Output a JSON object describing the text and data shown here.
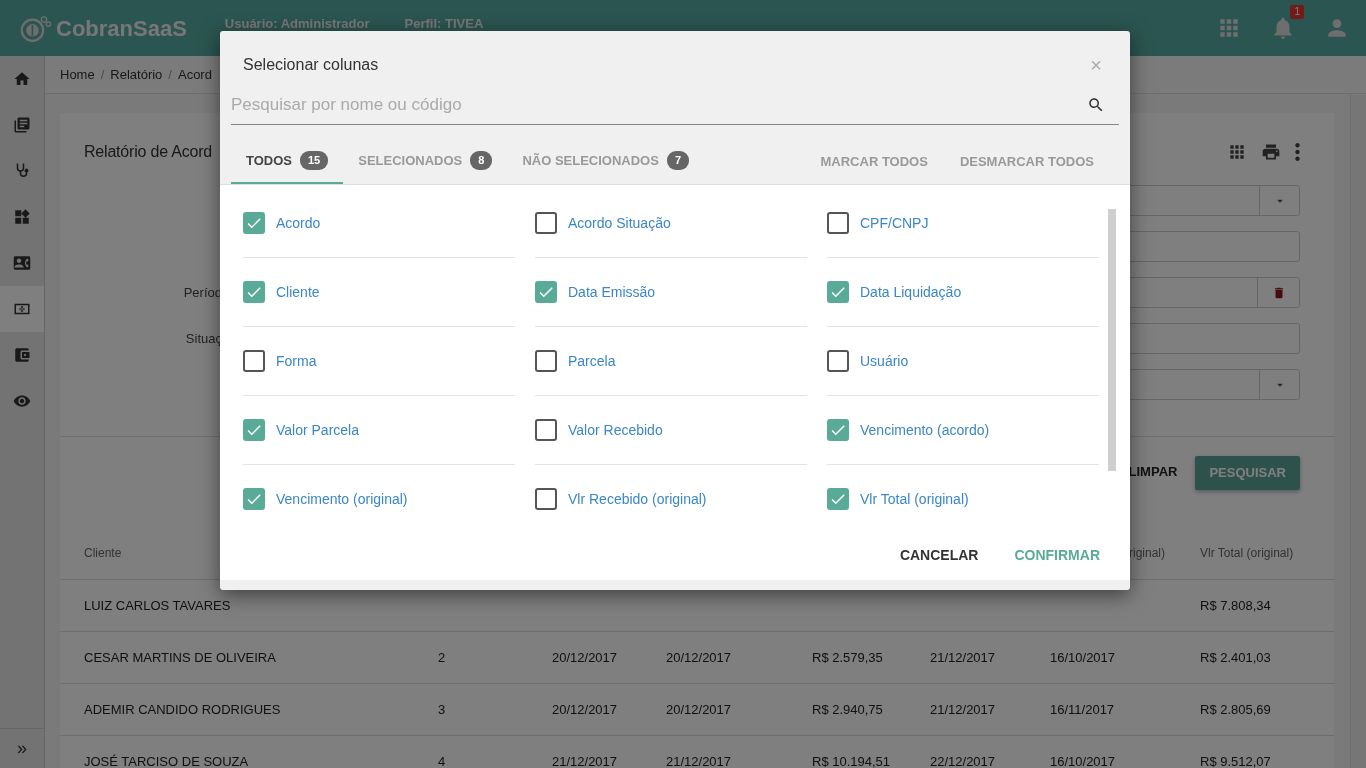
{
  "topbar": {
    "logo": "CobranSaaS",
    "user": "Usuário: Administrador",
    "profile": "Perfil: TIVEA",
    "notifications": "1"
  },
  "sidebar": {
    "items": [
      {
        "kind": "home",
        "selected": false
      },
      {
        "kind": "books",
        "selected": false
      },
      {
        "kind": "stethoscope",
        "selected": false
      },
      {
        "kind": "widgets",
        "selected": false
      },
      {
        "kind": "contact",
        "selected": false
      },
      {
        "kind": "money",
        "selected": true
      },
      {
        "kind": "wallet",
        "selected": false
      },
      {
        "kind": "eye",
        "selected": false
      }
    ],
    "collapse": "»"
  },
  "breadcrumb": {
    "items": [
      "Home",
      "Relatório",
      "Acord"
    ],
    "separators": [
      "/",
      "/"
    ]
  },
  "report": {
    "title": "Relatório de Acord",
    "fields": [
      {
        "kind": "select"
      },
      {
        "kind": "input"
      },
      {
        "kind": "input-clear",
        "label": "Períod"
      },
      {
        "kind": "input",
        "label": "Situaç"
      },
      {
        "kind": "select"
      }
    ],
    "buttons": [
      "LIMPAR",
      "PESQUISAR"
    ]
  },
  "table": {
    "header": {
      "column_1": "Cliente",
      "column_7": "riginal)",
      "column_8": "Vlr Total (original)"
    },
    "rows": [
      {
        "column_1": "LUIZ CARLOS TAVARES",
        "column_8": "R$ 7.808,34"
      },
      {
        "column_1": "CESAR MARTINS DE OLIVEIRA",
        "column_2": "2",
        "column_3": "20/12/2017",
        "column_4": "20/12/2017",
        "column_5": "R$ 2.579,35",
        "column_6": "21/12/2017",
        "column_7": "16/10/2017",
        "column_8": "R$ 2.401,03"
      },
      {
        "column_1": "ADEMIR CANDIDO RODRIGUES",
        "column_2": "3",
        "column_3": "20/12/2017",
        "column_4": "20/12/2017",
        "column_5": "R$ 2.940,75",
        "column_6": "21/12/2017",
        "column_7": "16/11/2017",
        "column_8": "R$ 2.805,69"
      },
      {
        "column_1": "JOSÉ TARCISO DE SOUZA",
        "column_2": "4",
        "column_3": "21/12/2017",
        "column_4": "21/12/2017",
        "column_5": "R$ 10.194,51",
        "column_6": "22/12/2017",
        "column_7": "16/10/2017",
        "column_8": "R$ 9.512,07"
      }
    ]
  },
  "modal": {
    "title": "Selecionar colunas",
    "close": "×",
    "search": {
      "placeholder": "Pesquisar por nome ou código"
    },
    "tabs": [
      {
        "label": "TODOS",
        "count": "15",
        "selected": true
      },
      {
        "label": "SELECIONADOS",
        "count": "8",
        "selected": false
      },
      {
        "label": "NÃO SELECIONADOS",
        "count": "7",
        "selected": false
      }
    ],
    "actions": [
      "MARCAR TODOS",
      "DESMARCAR TODOS"
    ],
    "columns": [
      {
        "label": "Acordo",
        "checked": true
      },
      {
        "label": "Acordo Situação",
        "checked": false
      },
      {
        "label": "CPF/CNPJ",
        "checked": false
      },
      {
        "label": "Cliente",
        "checked": true
      },
      {
        "label": "Data Emissão",
        "checked": true
      },
      {
        "label": "Data Liquidação",
        "checked": true
      },
      {
        "label": "Forma",
        "checked": false
      },
      {
        "label": "Parcela",
        "checked": false
      },
      {
        "label": "Usuário",
        "checked": false
      },
      {
        "label": "Valor Parcela",
        "checked": true
      },
      {
        "label": "Valor Recebido",
        "checked": false
      },
      {
        "label": "Vencimento (acordo)",
        "checked": true
      },
      {
        "label": "Vencimento (original)",
        "checked": true
      },
      {
        "label": "Vlr Recebido (original)",
        "checked": false
      },
      {
        "label": "Vlr Total (original)",
        "checked": true
      }
    ],
    "buttons": [
      "CANCELAR",
      "CONFIRMAR"
    ]
  }
}
